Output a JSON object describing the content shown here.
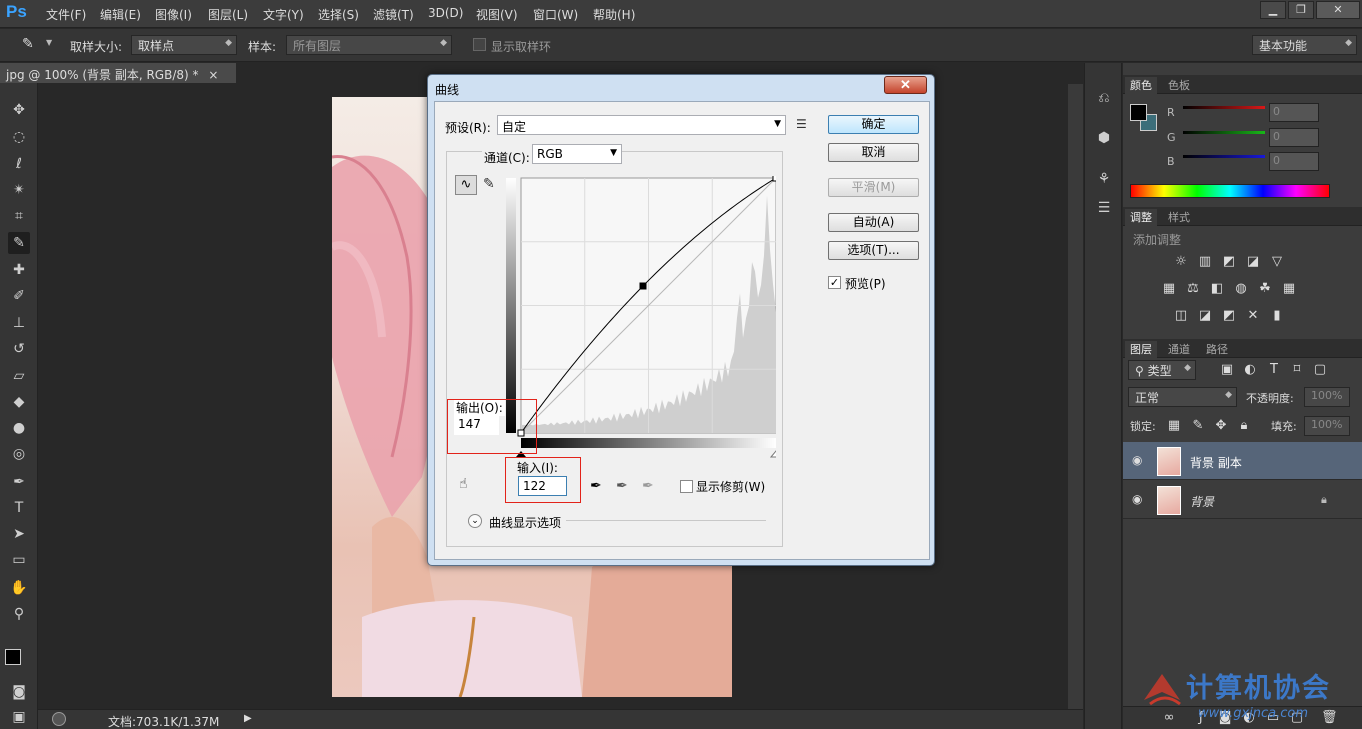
{
  "app": {
    "logo": "Ps"
  },
  "menu": [
    "文件(F)",
    "编辑(E)",
    "图像(I)",
    "图层(L)",
    "文字(Y)",
    "选择(S)",
    "滤镜(T)",
    "3D(D)",
    "视图(V)",
    "窗口(W)",
    "帮助(H)"
  ],
  "window_controls": {
    "minimize": "▁",
    "restore": "❐",
    "close": "✕"
  },
  "options": {
    "sample_size_label": "取样大小:",
    "sample_size_value": "取样点",
    "sample_label": "样本:",
    "sample_value": "所有图层",
    "show_ring_label": "显示取样环",
    "workspace": "基本功能"
  },
  "document": {
    "tab_title": "jpg @ 100% (背景 副本, RGB/8) *",
    "tab_close": "×",
    "status": "文档:703.1K/1.37M"
  },
  "panels": {
    "color": {
      "tab": "颜色",
      "tab2": "色板",
      "channels": [
        {
          "label": "R",
          "value": "0",
          "color": "#d81818"
        },
        {
          "label": "G",
          "value": "0",
          "color": "#18b818"
        },
        {
          "label": "B",
          "value": "0",
          "color": "#1818d8"
        }
      ]
    },
    "adjust": {
      "tab": "调整",
      "tab2": "样式",
      "title": "添加调整"
    },
    "layers": {
      "tab": "图层",
      "tab2": "通道",
      "tab3": "路径",
      "filter": "类型",
      "blend": "正常",
      "opacity_label": "不透明度:",
      "opacity": "100%",
      "lock_label": "锁定:",
      "fill_label": "填充:",
      "fill": "100%",
      "items": [
        {
          "name": "背景 副本",
          "selected": true
        },
        {
          "name": "背景",
          "selected": false
        }
      ]
    }
  },
  "dialog": {
    "title": "曲线",
    "close": "✕",
    "preset_label": "预设(R):",
    "preset_value": "自定",
    "channel_label": "通道(C):",
    "channel_value": "RGB",
    "output_label": "输出(O):",
    "output_value": "147",
    "input_label": "输入(I):",
    "input_value": "122",
    "show_clipping": "显示修剪(W)",
    "curve_options": "曲线显示选项",
    "buttons": {
      "ok": "确定",
      "cancel": "取消",
      "smooth": "平滑(M)",
      "auto": "自动(A)",
      "options": "选项(T)..."
    },
    "preview": "预览(P)",
    "curve": {
      "points": [
        [
          0,
          0
        ],
        [
          122,
          147
        ],
        [
          255,
          255
        ]
      ]
    }
  },
  "watermark": {
    "text": "计算机协会",
    "url": "www.gxjnca.com"
  }
}
